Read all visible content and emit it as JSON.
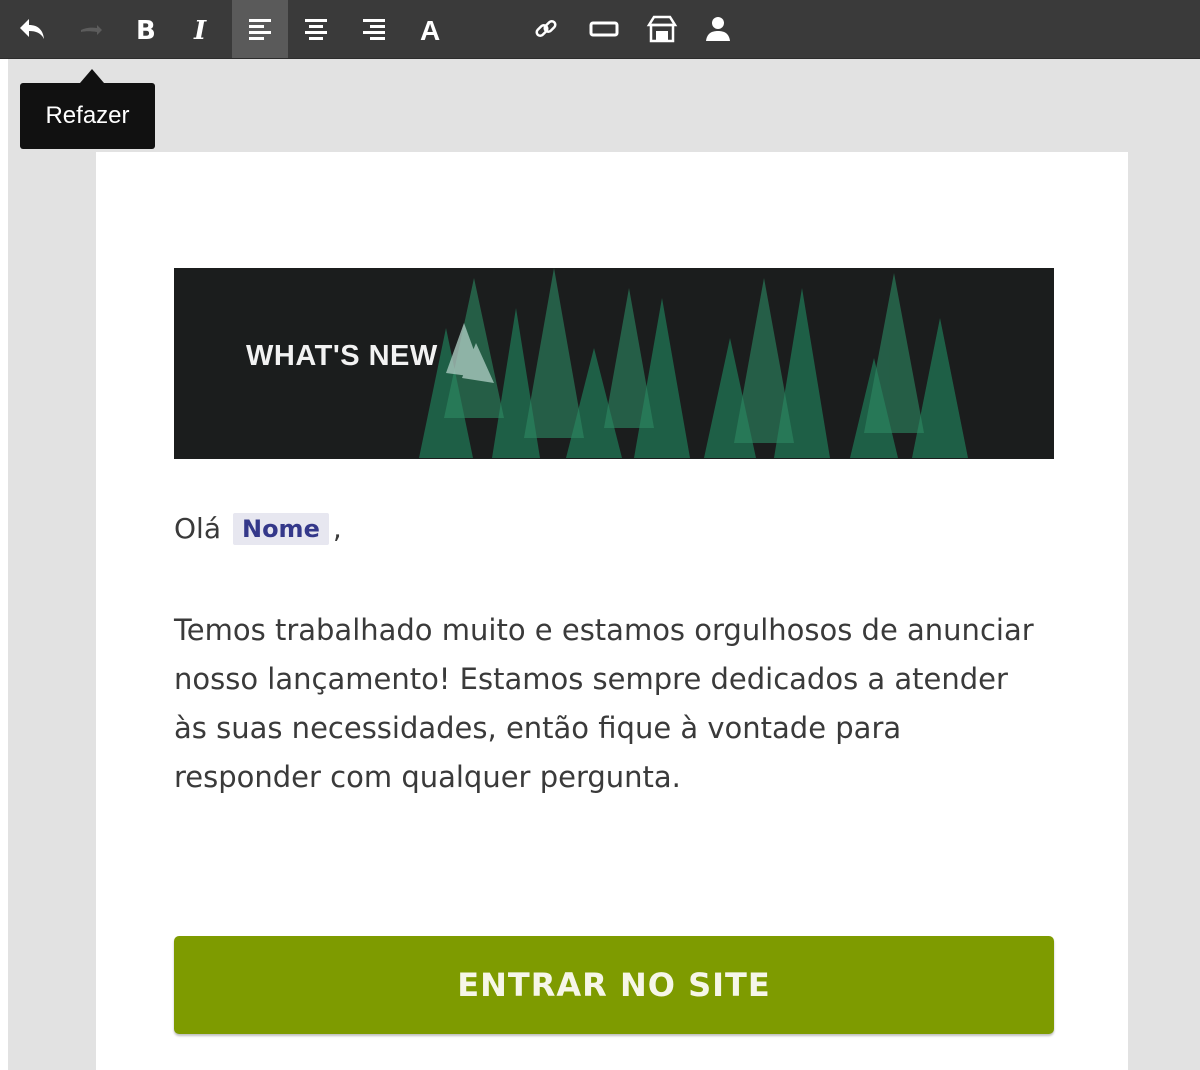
{
  "toolbar": {
    "buttons": [
      {
        "name": "undo",
        "icon": "undo-icon"
      },
      {
        "name": "redo",
        "icon": "redo-icon",
        "disabled": true
      },
      {
        "name": "bold",
        "icon": "bold-icon"
      },
      {
        "name": "italic",
        "icon": "italic-icon"
      },
      {
        "name": "align-left",
        "icon": "align-left-icon",
        "active": true
      },
      {
        "name": "align-center",
        "icon": "align-center-icon"
      },
      {
        "name": "align-right",
        "icon": "align-right-icon"
      },
      {
        "name": "font",
        "icon": "font-icon"
      },
      {
        "name": "link",
        "icon": "link-icon"
      },
      {
        "name": "button",
        "icon": "button-icon"
      },
      {
        "name": "store",
        "icon": "store-icon"
      },
      {
        "name": "contact",
        "icon": "person-icon"
      }
    ],
    "colors": {
      "background": "#3a3a3a",
      "active": "#5a5a5a",
      "icon": "#ffffff",
      "disabled": "#5c5c5c"
    }
  },
  "tooltip": {
    "text": "Refazer"
  },
  "email": {
    "banner_title": "WHAT'S NEW",
    "greeting": "Olá",
    "merge_tag": "Nome",
    "greeting_suffix": ",",
    "body": "Temos trabalhado muito e estamos orgulhosos de anunciar nosso lançamento! Estamos sempre dedicados a atender às suas necessidades, então fique à vontade para responder com qualquer pergunta.",
    "cta_label": "ENTRAR NO SITE",
    "colors": {
      "cta": "#7e9b00",
      "merge_tag_text": "#34388a",
      "merge_tag_bg": "#e7e7f0",
      "banner_bg": "#1b1d1d"
    }
  }
}
